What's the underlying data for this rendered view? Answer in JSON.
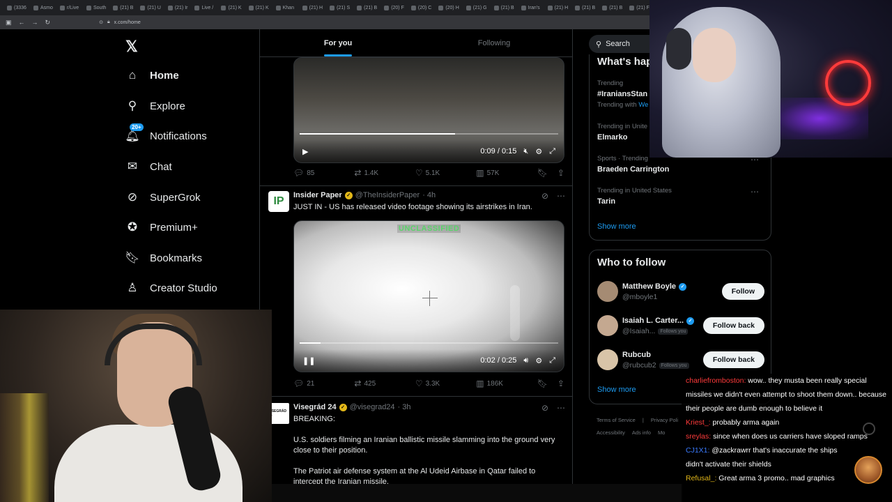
{
  "browser": {
    "tabs": [
      "(3336",
      "Asmo",
      "r/Live",
      "South",
      "(21) B",
      "(21) U",
      "(21) Ir",
      "Live /",
      "(21) K",
      "(21) K",
      "Khan",
      "(21) H",
      "(21) S",
      "(21) B",
      "(20) F",
      "(20) C",
      "(20) H",
      "(21) G",
      "(21) B",
      "Iran's",
      "(21) H",
      "(21) B",
      "(21) B",
      "(21) F"
    ],
    "url": "x.com/home"
  },
  "sidebar": {
    "items": [
      {
        "label": "Home",
        "icon": "home-icon"
      },
      {
        "label": "Explore",
        "icon": "search-icon"
      },
      {
        "label": "Notifications",
        "icon": "bell-icon",
        "badge": "20+"
      },
      {
        "label": "Chat",
        "icon": "mail-icon"
      },
      {
        "label": "SuperGrok",
        "icon": "grok-icon"
      },
      {
        "label": "Premium+",
        "icon": "verified-badge-icon"
      },
      {
        "label": "Bookmarks",
        "icon": "bookmark-icon"
      },
      {
        "label": "Creator Studio",
        "icon": "creator-studio-icon"
      }
    ]
  },
  "feed": {
    "tabs": [
      "For you",
      "Following"
    ],
    "video1": {
      "time": "0:09 / 0:15",
      "progress": 0.6
    },
    "post1_stats": {
      "replies": "85",
      "reposts": "1.4K",
      "likes": "5.1K",
      "views": "57K"
    },
    "post2": {
      "name": "Insider Paper",
      "handle": "@TheInsiderPaper",
      "time": "· 4h",
      "avatar_text": "IP",
      "text": "JUST IN - US has released video footage showing its airstrikes in Iran.",
      "video_overlay": "UNCLASSIFIED",
      "video_time": "0:02 / 0:25",
      "progress": 0.08,
      "stats": {
        "replies": "21",
        "reposts": "425",
        "likes": "3.3K",
        "views": "186K"
      }
    },
    "post3": {
      "name": "Visegrád 24",
      "handle": "@visegrad24",
      "time": "· 3h",
      "avatar_text": "VISEGRÁD 24",
      "paragraphs": [
        "BREAKING:",
        "U.S. soldiers filming an Iranian ballistic missile slamming into the ground very close to their position.",
        "The Patriot air defense system at the Al Udeid Airbase in Qatar failed to intercept the Iranian missile."
      ]
    }
  },
  "right": {
    "search_placeholder": "Search",
    "trends_title": "What's hap",
    "trends": [
      {
        "meta": "Trending",
        "topic": "#IraniansStan",
        "sub_prefix": "Trending with",
        "sub_link": "We"
      },
      {
        "meta": "Trending in Unite",
        "topic": "Elmarko"
      },
      {
        "meta": "Sports · Trending",
        "topic": "Braeden Carrington"
      },
      {
        "meta": "Trending in United States",
        "topic": "Tarin"
      }
    ],
    "show_more": "Show more",
    "who_to_follow_title": "Who to follow",
    "who_to_follow": [
      {
        "name": "Matthew Boyle",
        "handle": "@mboyle1",
        "button": "Follow",
        "follows_you": ""
      },
      {
        "name": "Isaiah L. Carter...",
        "handle": "@Isaiah...",
        "button": "Follow back",
        "follows_you": "Follows you"
      },
      {
        "name": "Rubcub",
        "handle": "@rubcub2",
        "button": "Follow back",
        "follows_you": "Follows you"
      }
    ],
    "footer": [
      "Terms of Service",
      "|",
      "Privacy Poli",
      "Accessibility",
      "Ads info",
      "Mo"
    ]
  },
  "chat": [
    {
      "user": "charliefromboston:",
      "color": "#ff3b3b",
      "msg": "wow.. they musta been really special missiles we didn't even attempt to shoot them down.. because their people are dumb enough to believe it"
    },
    {
      "user": "Kriest_:",
      "color": "#ff3b3b",
      "msg": "probably arma again"
    },
    {
      "user": "sreylas:",
      "color": "#ff3b3b",
      "msg": "since when does us carriers have sloped ramps"
    },
    {
      "user": "CJ1X1:",
      "color": "#3b7bff",
      "msg": "@zackrawrr that's inaccurate the ships didn't activate their shields"
    },
    {
      "user": "Refusal_:",
      "color": "#e2b719",
      "msg": "Great arma 3 promo.. mad graphics"
    }
  ]
}
